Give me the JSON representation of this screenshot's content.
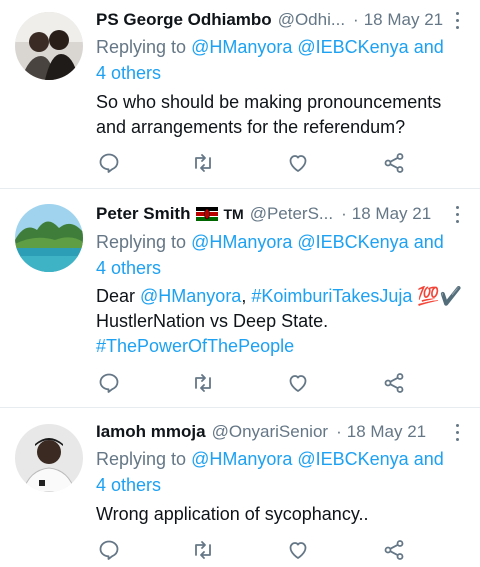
{
  "tweets": [
    {
      "name": "PS George Odhiambo",
      "handle": "@Odhi...",
      "sep": "·",
      "date": "18 May 21",
      "reply_prefix": "Replying to ",
      "reply_mentions": "@HManyora @IEBCKenya and",
      "reply_others": "4 others",
      "text": "So who should be making pronouncements and arrangements for the referendum?"
    },
    {
      "name": "Peter Smith",
      "tm": "TM",
      "handle": "@PeterS...",
      "sep": "·",
      "date": "18 May 21",
      "reply_prefix": "Replying to ",
      "reply_mentions": "@HManyora @IEBCKenya and",
      "reply_others": "4 others",
      "text_prefix": "Dear ",
      "text_mention": "@HManyora",
      "text_comma": ", ",
      "text_hashtag1": "#KoimburiTakesJuja",
      "text_emoji": " 💯✔️",
      "text_line2": "HustlerNation vs Deep State.",
      "text_hashtag2": "#ThePowerOfThePeople"
    },
    {
      "name": "Iamoh mmoja",
      "handle": "@OnyariSenior",
      "sep": "·",
      "date": "18 May 21",
      "reply_prefix": "Replying to ",
      "reply_mentions": "@HManyora @IEBCKenya and",
      "reply_others": "4 others",
      "text": "Wrong application of sycophancy.."
    }
  ],
  "icons": {
    "reply": "reply-icon",
    "retweet": "retweet-icon",
    "like": "like-icon",
    "share": "share-icon",
    "more": "more-icon"
  },
  "colors": {
    "link": "#1da1f2",
    "muted": "#657786",
    "text": "#0f1419",
    "divider": "#e6ecf0"
  }
}
